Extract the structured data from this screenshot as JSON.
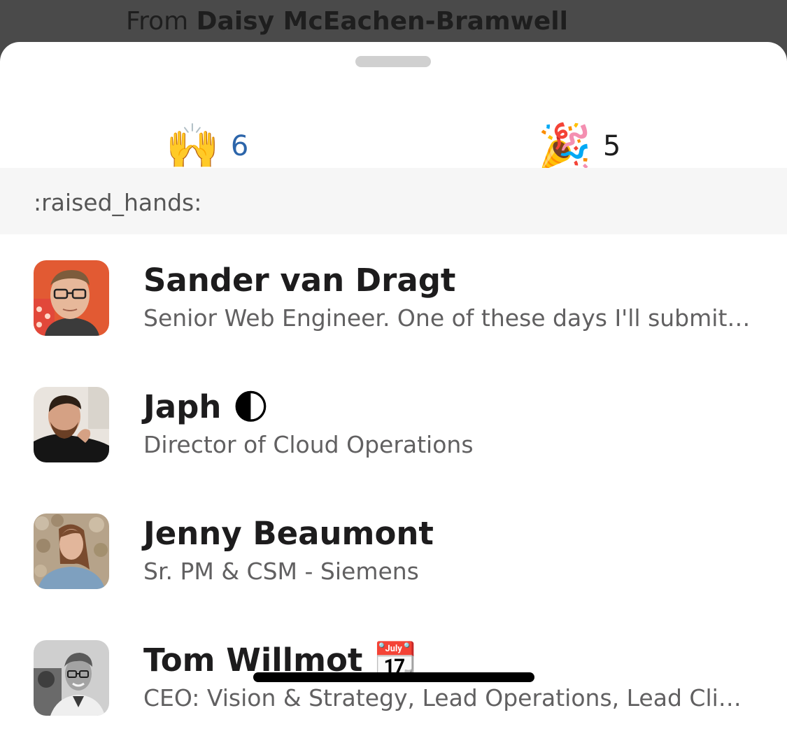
{
  "background_header": {
    "prefix": "From",
    "sender": "Daisy McEachen-Bramwell"
  },
  "tabs": [
    {
      "emoji": "🙌",
      "count": "6",
      "icon": "raised-hands-icon",
      "selected": true
    },
    {
      "emoji": "🎉",
      "count": "5",
      "icon": "party-popper-icon",
      "selected": false
    }
  ],
  "colors": {
    "accent": "#2c65aa",
    "name_text": "#1d1c1d",
    "subtitle_text": "#616061",
    "section_bg": "#f6f6f6"
  },
  "section": {
    "label": ":raised_hands:"
  },
  "people": [
    {
      "name": "Sander van Dragt",
      "status_emoji": "",
      "title": "Senior Web Engineer. One of these days I'll submit a talk",
      "avatar": "avatar-photo"
    },
    {
      "name": "Japh",
      "status_emoji": "🌓",
      "title": "Director of Cloud Operations",
      "avatar": "avatar-photo"
    },
    {
      "name": "Jenny Beaumont",
      "status_emoji": "",
      "title": "Sr. PM & CSM - Siemens",
      "avatar": "avatar-photo"
    },
    {
      "name": "Tom Willmot",
      "status_emoji": "📆",
      "title": "CEO: Vision & Strategy, Lead Operations, Lead Client Relations",
      "avatar": "avatar-photo"
    }
  ]
}
